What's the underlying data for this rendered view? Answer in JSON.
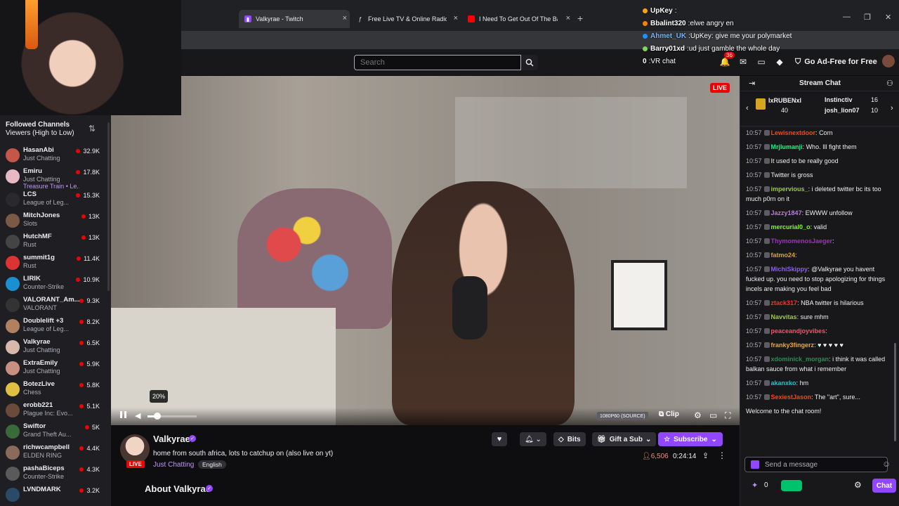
{
  "browser": {
    "tabs": [
      {
        "title": "Valkyrae - Twitch",
        "active": true
      },
      {
        "title": "Free Live TV & Online Radio W",
        "active": false
      },
      {
        "title": "I Need To Get Out Of The Back",
        "active": false
      }
    ],
    "new_tab_symbol": "+"
  },
  "overlay_chat": [
    {
      "user": "UpKey",
      "text": "",
      "color": "#ff9f1a"
    },
    {
      "user": "Bbalint320",
      "text": "elwe angry en",
      "color": "#ff7f00"
    },
    {
      "user": "Ahmet_UK",
      "text": "UpKey: give me your polymarket",
      "color": "#1e90ff"
    },
    {
      "user": "Barry01xd",
      "text": "ud just gamble the whole day",
      "color": "#7ed957"
    },
    {
      "user": "0",
      "text": "VR chat",
      "color": "#cccccc"
    }
  ],
  "topnav": {
    "search_placeholder": "Search",
    "notification_count": "36",
    "adfree_label": "Go Ad-Free for Free"
  },
  "sidebar": {
    "title": "Followed Channels",
    "sort": "Viewers (High to Low)",
    "channels": [
      {
        "name": "HasanAbi",
        "game": "Just Chatting",
        "viewers": "32.9K",
        "color": "#c4564a"
      },
      {
        "name": "Emiru",
        "game": "Just Chatting",
        "extra": "Treasure Train • Le...",
        "viewers": "17.8K",
        "color": "#e8b9c5"
      },
      {
        "name": "LCS",
        "game": "League of Leg...",
        "viewers": "15.3K",
        "color": "#2a2a2e"
      },
      {
        "name": "MitchJones",
        "game": "Slots",
        "viewers": "13K",
        "color": "#7a5a46"
      },
      {
        "name": "HutchMF",
        "game": "Rust",
        "viewers": "13K",
        "color": "#444"
      },
      {
        "name": "summit1g",
        "game": "Rust",
        "viewers": "11.4K",
        "color": "#d33"
      },
      {
        "name": "LIRIK",
        "game": "Counter-Strike",
        "viewers": "10.9K",
        "color": "#1a8fd1"
      },
      {
        "name": "VALORANT_Am...",
        "game": "VALORANT",
        "viewers": "9.3K",
        "color": "#333"
      },
      {
        "name": "Doublelift +3",
        "game": "League of Leg...",
        "viewers": "8.2K",
        "color": "#b08060"
      },
      {
        "name": "Valkyrae",
        "game": "Just Chatting",
        "viewers": "6.5K",
        "color": "#d8b8aa"
      },
      {
        "name": "ExtraEmily",
        "game": "Just Chatting",
        "viewers": "5.9K",
        "color": "#c89080"
      },
      {
        "name": "BotezLive",
        "game": "Chess",
        "viewers": "5.8K",
        "color": "#e0c040"
      },
      {
        "name": "erobb221",
        "game": "Plague Inc: Evo...",
        "viewers": "5.1K",
        "color": "#6a4a3a"
      },
      {
        "name": "Swiftor",
        "game": "Grand Theft Au...",
        "viewers": "5K",
        "color": "#3a6a3a"
      },
      {
        "name": "richwcampbell",
        "game": "ELDEN RING",
        "viewers": "4.4K",
        "color": "#8a6a5a"
      },
      {
        "name": "pashaBiceps",
        "game": "Counter-Strike",
        "viewers": "4.3K",
        "color": "#5a5a5a"
      },
      {
        "name": "LVNDMARK",
        "game": "",
        "viewers": "3.2K",
        "color": "#2a4a6a"
      }
    ]
  },
  "player": {
    "live_badge": "LIVE",
    "volume_tooltip": "20%",
    "volume_level": 0.2,
    "quality": "1080P60 (SOURCE)",
    "clip_label": "Clip"
  },
  "channel": {
    "name": "Valkyrae",
    "live_label": "LIVE",
    "title": "home from south africa, lots to catchup on (also live on yt)",
    "category": "Just Chatting",
    "tag": "English",
    "bits_label": "Bits",
    "gift_label": "Gift a Sub",
    "subscribe_label": "Subscribe",
    "viewers": "6,506",
    "uptime": "0:24:14",
    "about_heading": "About Valkyrae"
  },
  "chat": {
    "title": "Stream Chat",
    "leaderboard": {
      "first_name": "lxRUBENxl",
      "first_score": "40",
      "rows": [
        {
          "name": "Instinctiv",
          "score": "16"
        },
        {
          "name": "josh_lion07",
          "score": "10"
        }
      ]
    },
    "messages": [
      {
        "ts": "10:57",
        "user": "Lewisnextdoor",
        "text": "Corn",
        "color": "#ff4500"
      },
      {
        "ts": "10:57",
        "user": "Mrjlumanji",
        "text": "Who. Ill fight them",
        "color": "#00ff7f"
      },
      {
        "ts": "10:57",
        "user": "",
        "text": "It used to be really good",
        "color": "#5c5cff"
      },
      {
        "ts": "10:57",
        "user": "",
        "text": "Twitter is gross",
        "color": "#8a2be2"
      },
      {
        "ts": "10:57",
        "user": "impervious_",
        "text": "i deleted twitter bc its too much p0rn on it",
        "color": "#9acd32"
      },
      {
        "ts": "10:57",
        "user": "Jazzy1847",
        "text": "EWWW unfollow",
        "color": "#b57edc"
      },
      {
        "ts": "10:57",
        "user": "mercurial0_o",
        "text": "valid",
        "color": "#7fff00"
      },
      {
        "ts": "10:57",
        "user": "ThymomenosJaeger",
        "text": "",
        "color": "#9932cc"
      },
      {
        "ts": "10:57",
        "user": "fatmo24",
        "text": "",
        "color": "#daa520"
      },
      {
        "ts": "10:57",
        "user": "MichiSkippy",
        "text": "@Valkyrae you havent fucked up. you need to stop apologizing for things incels are making you feel bad",
        "color": "#8a5cf6"
      },
      {
        "ts": "10:57",
        "user": "ztack317",
        "text": "NBA twitter is hilarious",
        "color": "#ff3030"
      },
      {
        "ts": "10:57",
        "user": "Navvitas",
        "text": "sure mhm",
        "color": "#9acd32"
      },
      {
        "ts": "10:57",
        "user": "peaceandjoyvibes",
        "text": "",
        "color": "#ff4d6d"
      },
      {
        "ts": "10:57",
        "user": "franky3fingerz",
        "text": "♥ ♥ ♥ ♥ ♥",
        "color": "#f5a623"
      },
      {
        "ts": "10:57",
        "user": "xdominick_morgan",
        "text": "i think it was called balkan sauce from what i remember",
        "color": "#2e8b57"
      },
      {
        "ts": "10:57",
        "user": "akanxko",
        "text": "hm",
        "color": "#00ced1"
      },
      {
        "ts": "10:57",
        "user": "SexiestJason",
        "text": "The \"art\", sure...",
        "color": "#ff4500"
      }
    ],
    "welcome": "Welcome to the chat room!",
    "input_placeholder": "Send a message",
    "points": "0",
    "send_label": "Chat"
  }
}
